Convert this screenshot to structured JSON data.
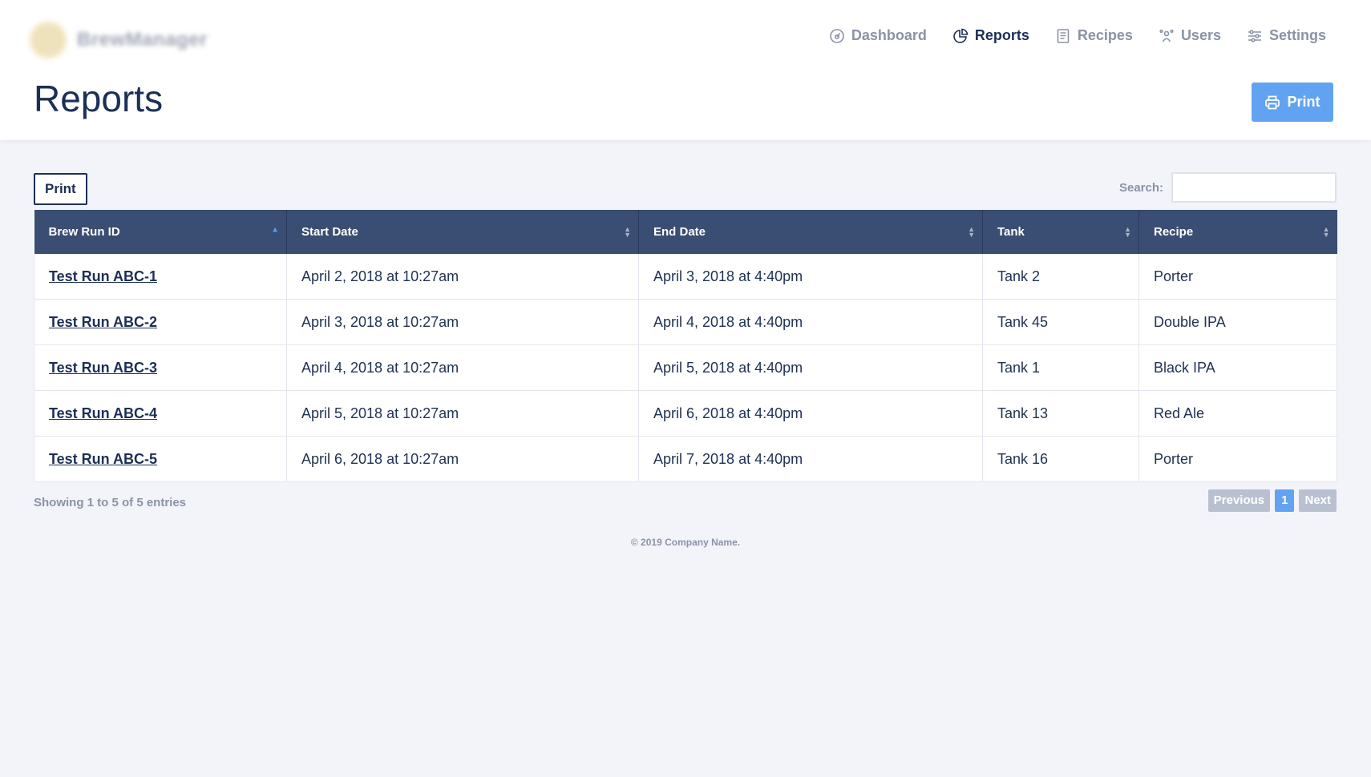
{
  "header": {
    "brand_name": "BrewManager",
    "nav": [
      {
        "label": "Dashboard",
        "icon": "dashboard-icon",
        "active": false
      },
      {
        "label": "Reports",
        "icon": "reports-icon",
        "active": true
      },
      {
        "label": "Recipes",
        "icon": "recipes-icon",
        "active": false
      },
      {
        "label": "Users",
        "icon": "users-icon",
        "active": false
      },
      {
        "label": "Settings",
        "icon": "settings-icon",
        "active": false
      }
    ],
    "page_title": "Reports",
    "print_button_label": "Print"
  },
  "toolbar": {
    "print_label": "Print",
    "search_label": "Search:",
    "search_value": ""
  },
  "table": {
    "columns": [
      "Brew Run ID",
      "Start Date",
      "End Date",
      "Tank",
      "Recipe"
    ],
    "sorted_column": "Brew Run ID",
    "sort_direction": "asc",
    "rows": [
      {
        "id": "Test Run ABC-1",
        "start": "April 2, 2018 at 10:27am",
        "end": "April 3, 2018 at 4:40pm",
        "tank": "Tank 2",
        "recipe": "Porter"
      },
      {
        "id": "Test Run ABC-2",
        "start": "April 3, 2018 at 10:27am",
        "end": "April 4, 2018 at 4:40pm",
        "tank": "Tank 45",
        "recipe": "Double IPA"
      },
      {
        "id": "Test Run ABC-3",
        "start": "April 4, 2018 at 10:27am",
        "end": "April 5, 2018 at 4:40pm",
        "tank": "Tank 1",
        "recipe": "Black IPA"
      },
      {
        "id": "Test Run ABC-4",
        "start": "April 5, 2018 at 10:27am",
        "end": "April 6, 2018 at 4:40pm",
        "tank": "Tank 13",
        "recipe": "Red Ale"
      },
      {
        "id": "Test Run ABC-5",
        "start": "April 6, 2018 at 10:27am",
        "end": "April 7, 2018 at 4:40pm",
        "tank": "Tank 16",
        "recipe": "Porter"
      }
    ]
  },
  "pagination": {
    "info": "Showing 1 to 5 of 5 entries",
    "previous": "Previous",
    "current": "1",
    "next": "Next"
  },
  "footer": {
    "copyright": "© 2019 Company Name."
  },
  "colors": {
    "primary": "#62a3f1",
    "header_bg": "#3a4d72",
    "text": "#1c2f57",
    "muted": "#8a93a6",
    "page_bg": "#f3f4f9"
  }
}
